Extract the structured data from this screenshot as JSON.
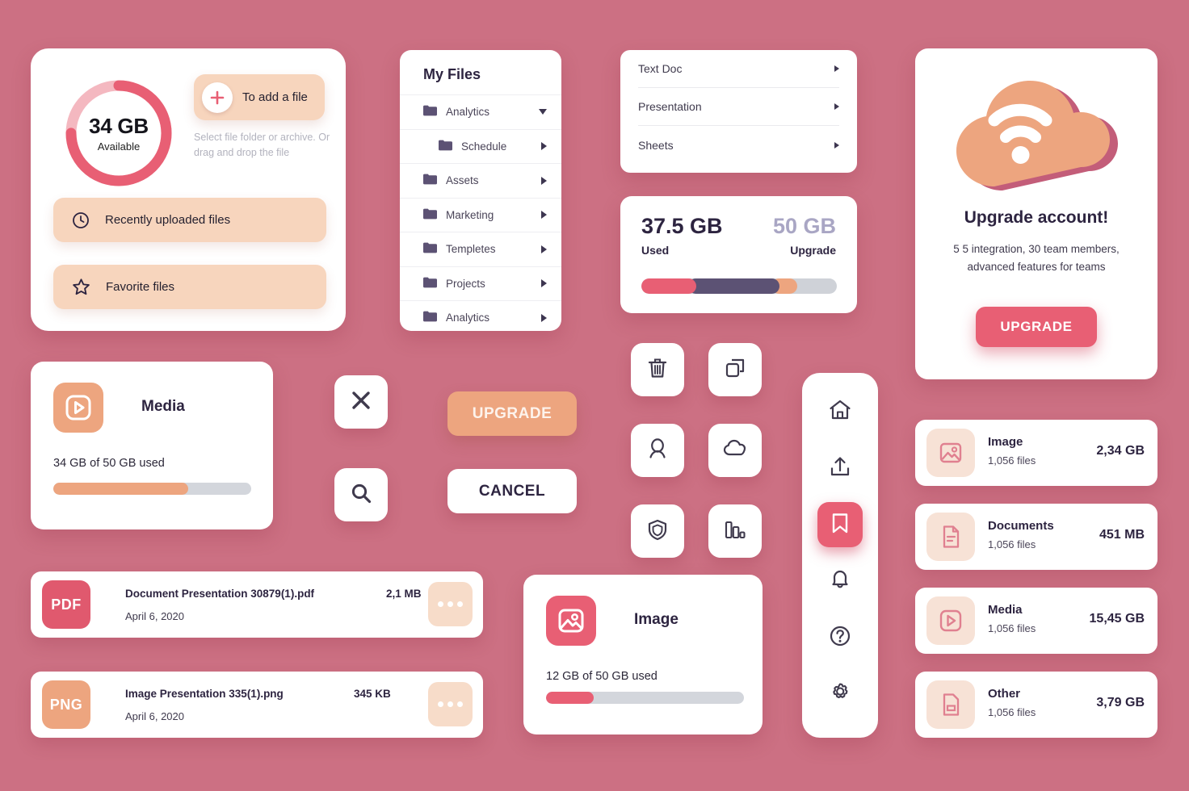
{
  "theme": {
    "background": "#cc7083",
    "accent_pink": "#e85f74",
    "accent_peach": "#eda57f",
    "accent_light_peach": "#f7d5bd",
    "dark_text": "#2d2440",
    "purple_bar": "#5c5274",
    "grey_track": "#cfd2d8"
  },
  "storage_card": {
    "donut": {
      "value": "34 GB",
      "label": "Available",
      "percent": 75
    },
    "add_file_button": "To add a file",
    "add_file_hint": "Select file folder or archive. Or drag and drop the file",
    "rows": [
      {
        "label": "Recently uploaded files",
        "icon": "clock-icon"
      },
      {
        "label": "Favorite files",
        "icon": "star-icon"
      }
    ]
  },
  "my_files": {
    "title": "My Files",
    "folders": [
      {
        "label": "Analytics",
        "indent": false,
        "caret": "down"
      },
      {
        "label": "Schedule",
        "indent": true,
        "caret": "right"
      },
      {
        "label": "Assets",
        "indent": false,
        "caret": "right"
      },
      {
        "label": "Marketing",
        "indent": false,
        "caret": "right"
      },
      {
        "label": "Templetes",
        "indent": false,
        "caret": "right"
      },
      {
        "label": "Projects",
        "indent": false,
        "caret": "right"
      },
      {
        "label": "Analytics",
        "indent": false,
        "caret": "right"
      }
    ]
  },
  "doc_types": {
    "items": [
      {
        "label": "Text Doc"
      },
      {
        "label": "Presentation"
      },
      {
        "label": "Sheets"
      }
    ]
  },
  "usage_card": {
    "used_value": "37.5 GB",
    "used_label": "Used",
    "total_value": "50 GB",
    "total_label": "Upgrade",
    "segments": [
      {
        "name": "pink",
        "percent": 28,
        "color": "#e85f74"
      },
      {
        "name": "purple",
        "percent": 47,
        "color": "#5c5274"
      },
      {
        "name": "peach",
        "percent": 13,
        "color": "#eda57f"
      },
      {
        "name": "grey",
        "percent": 12,
        "color": "#cfd2d8"
      }
    ]
  },
  "upgrade_card": {
    "icon": "cloud-wifi-icon",
    "title": "Upgrade account!",
    "description": "5 5 integration, 30 team members, advanced features for teams",
    "button": "UPGRADE"
  },
  "media_tile": {
    "icon": "play-icon",
    "title": "Media",
    "subtitle": "34 GB of 50 GB used",
    "progress_percent": 68,
    "bar_color": "#eda57f",
    "icon_bg": "#eda57f"
  },
  "image_tile": {
    "icon": "image-icon",
    "title": "Image",
    "subtitle": "12 GB of 50 GB used",
    "progress_percent": 24,
    "bar_color": "#e85f74",
    "icon_bg": "#e85f74"
  },
  "file_rows": [
    {
      "ext": "PDF",
      "ext_color": "#e0596e",
      "name": "Document Presentation 30879(1).pdf",
      "size": "2,1 MB",
      "date": "April 6, 2020"
    },
    {
      "ext": "PNG",
      "ext_color": "#eda57f",
      "name": "Image Presentation 335(1).png",
      "size": "345 KB",
      "date": "April 6, 2020"
    }
  ],
  "action_buttons": {
    "close": "close-icon",
    "search": "search-icon",
    "upgrade_label": "UPGRADE",
    "cancel_label": "CANCEL"
  },
  "tool_icons": [
    {
      "name": "trash-icon"
    },
    {
      "name": "copy-icon"
    },
    {
      "name": "user-icon"
    },
    {
      "name": "cloud-icon"
    },
    {
      "name": "shield-icon"
    },
    {
      "name": "chart-bars-icon"
    }
  ],
  "vertical_nav": [
    {
      "name": "home-icon",
      "active": false
    },
    {
      "name": "upload-icon",
      "active": false
    },
    {
      "name": "bookmark-icon",
      "active": true
    },
    {
      "name": "bell-icon",
      "active": false
    },
    {
      "name": "help-icon",
      "active": false
    },
    {
      "name": "gear-icon",
      "active": false
    }
  ],
  "categories": [
    {
      "icon": "image-icon",
      "name": "Image",
      "files": "1,056 files",
      "size": "2,34 GB"
    },
    {
      "icon": "document-icon",
      "name": "Documents",
      "files": "1,056 files",
      "size": "451 MB"
    },
    {
      "icon": "play-icon",
      "name": "Media",
      "files": "1,056 files",
      "size": "15,45 GB"
    },
    {
      "icon": "other-file-icon",
      "name": "Other",
      "files": "1,056 files",
      "size": "3,79 GB"
    }
  ]
}
